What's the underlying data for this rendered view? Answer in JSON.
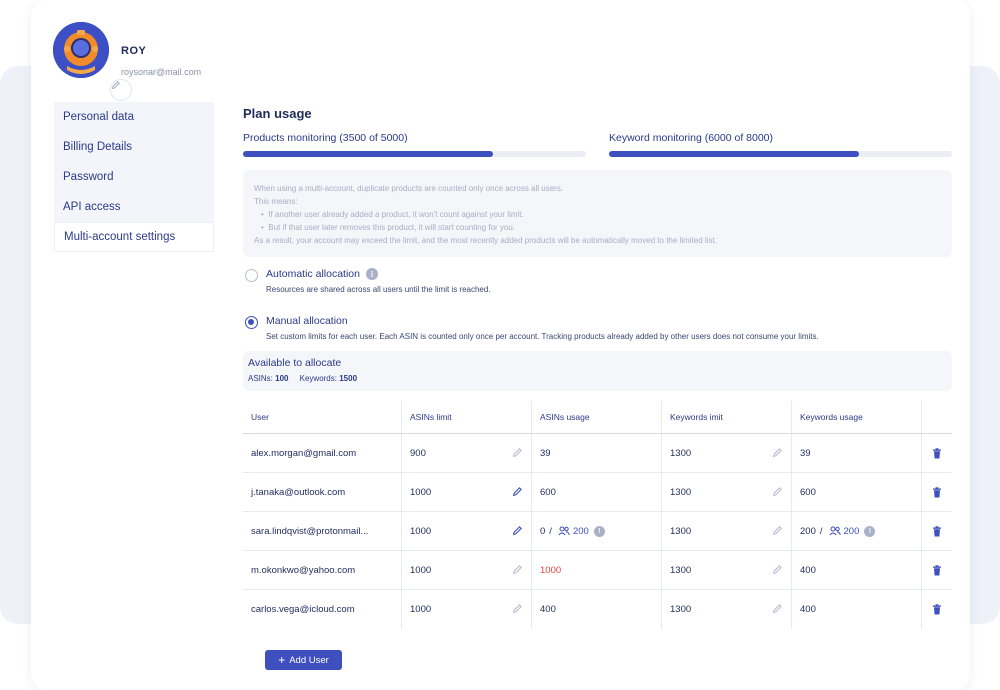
{
  "profile": {
    "name": "ROY",
    "email": "roysonar@mail.com"
  },
  "sidebar": {
    "items": [
      {
        "label": "Personal data"
      },
      {
        "label": "Billing Details"
      },
      {
        "label": "Password"
      },
      {
        "label": "API access"
      },
      {
        "label": "Multi-account settings",
        "active": true
      }
    ]
  },
  "plan": {
    "title": "Plan usage",
    "products_label": "Products monitoring (3500 of 5000)",
    "products_progress": 0.73,
    "keywords_label": "Keyword monitoring (6000 of 8000)",
    "keywords_progress": 0.73
  },
  "info": {
    "line1": "When using a multi-account, duplicate products are counted only once across all users.",
    "line2": "This means:",
    "bullet1": "If another user already added a product, it won't count against your limit.",
    "bullet2": "But if that user later removes this product, it will start counting for you.",
    "line3": "As a result, your account may exceed the limit, and the most recently added products will be automatically moved to the limited list."
  },
  "allocation": {
    "automatic_title": "Automatic allocation",
    "automatic_desc": "Resources are shared across all users until the limit is reached.",
    "manual_title": "Manual allocation",
    "manual_desc": "Set custom limits for each user. Each ASIN is counted only once per account. Tracking products already added by other users does not consume your limits.",
    "selected": "manual"
  },
  "available": {
    "title": "Available to allocate",
    "asins_label": "ASINs:",
    "asins_value": "100",
    "keywords_label": "Keywords:",
    "keywords_value": "1500"
  },
  "table": {
    "headers": [
      "User",
      "ASINs limit",
      "ASINs usage",
      "Keywords imit",
      "Keywords usage"
    ],
    "rows": [
      {
        "user": "alex.morgan@gmail.com",
        "asins_limit": "900",
        "asins_usage": "39",
        "keywords_limit": "1300",
        "keywords_usage": "39"
      },
      {
        "user": "j.tanaka@outlook.com",
        "asins_limit": "1000",
        "asins_usage": "600",
        "keywords_limit": "1300",
        "keywords_usage": "600"
      },
      {
        "user": "sara.lindqvist@protonmail...",
        "asins_limit": "1000",
        "asins_usage": "0",
        "asins_shared": "200",
        "keywords_limit": "1300",
        "keywords_usage": "200",
        "keywords_shared": "200"
      },
      {
        "user": "m.okonkwo@yahoo.com",
        "asins_limit": "1000",
        "asins_usage": "1000",
        "keywords_limit": "1300",
        "keywords_usage": "400"
      },
      {
        "user": "carlos.vega@icloud.com",
        "asins_limit": "1000",
        "asins_usage": "400",
        "keywords_limit": "1300",
        "keywords_usage": "400"
      }
    ],
    "separator": "/"
  },
  "add_user_label": "Add User",
  "colors": {
    "accent": "#3e4fbf",
    "danger": "#e0483d"
  }
}
